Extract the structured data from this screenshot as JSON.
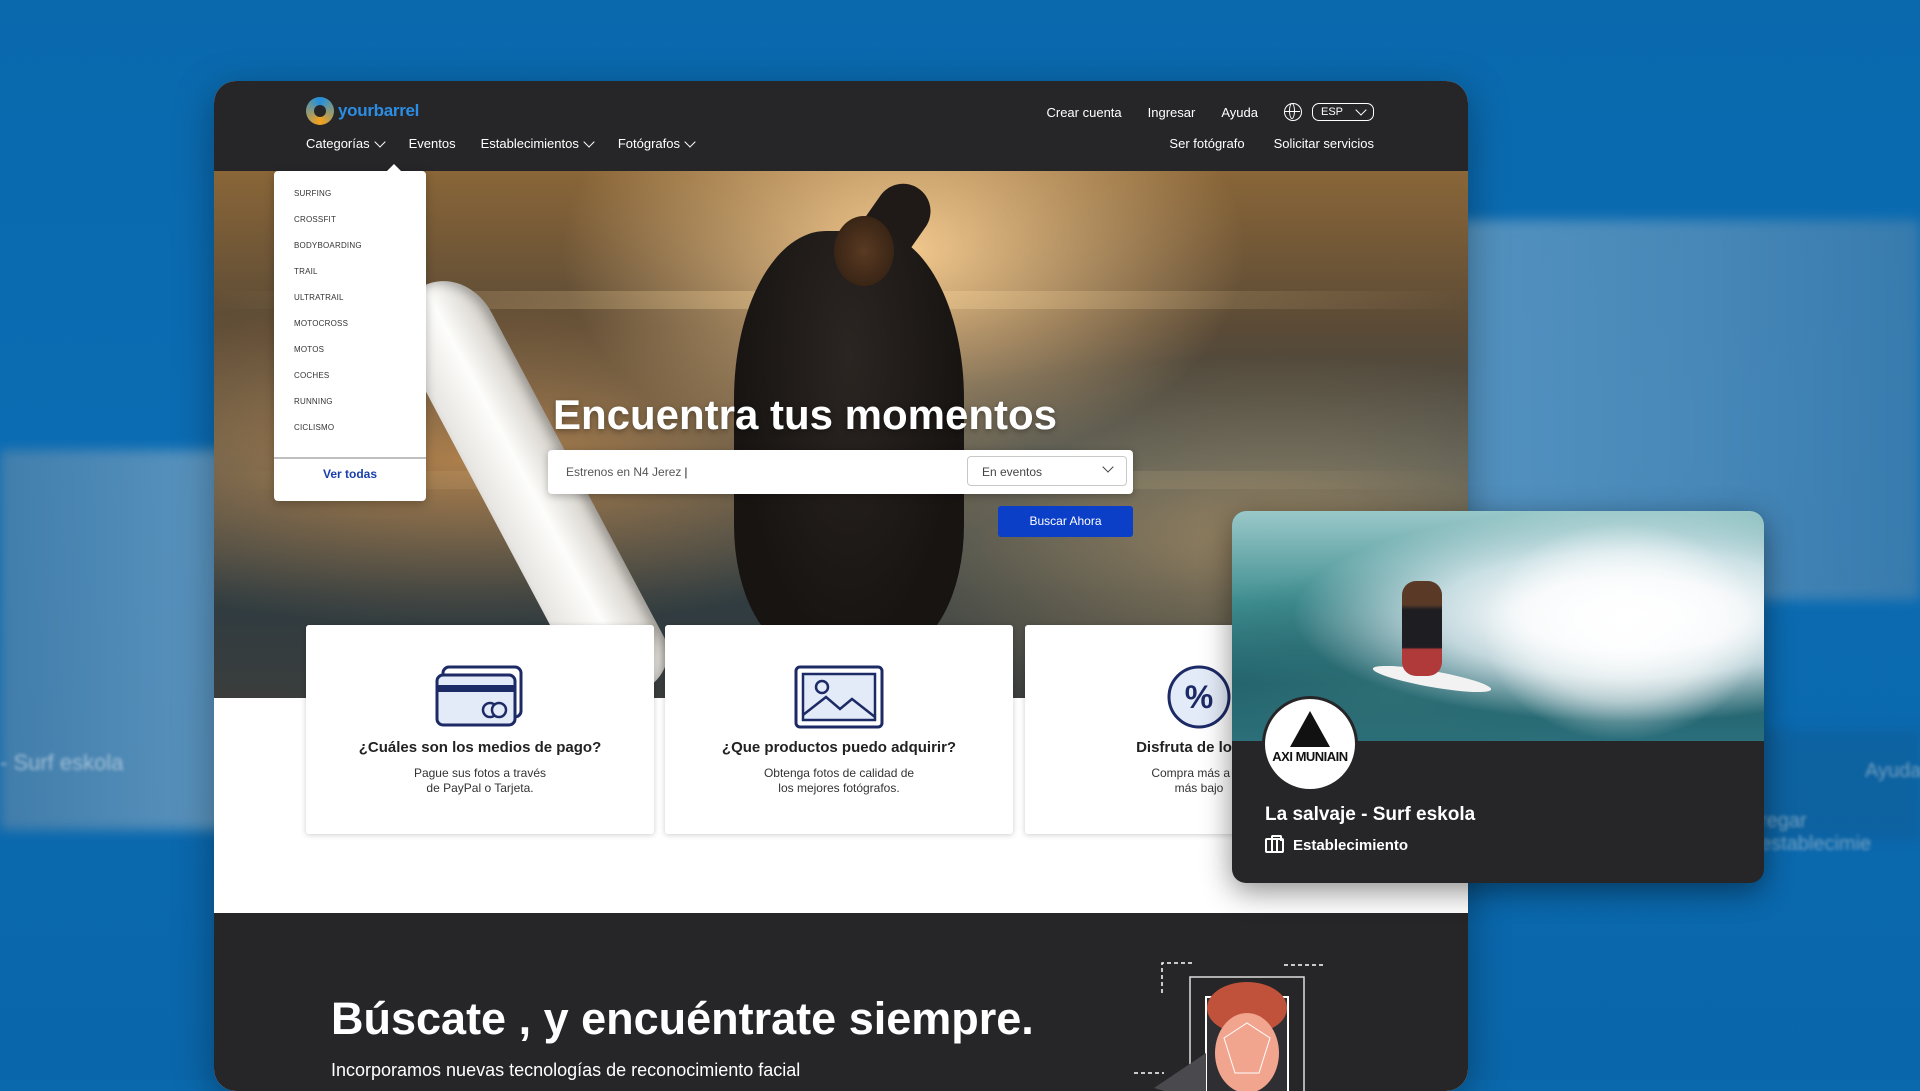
{
  "header": {
    "logo_text": "yourbarrel",
    "nav_left": [
      {
        "label": "Categorías",
        "has_chevron": true
      },
      {
        "label": "Eventos",
        "has_chevron": false
      },
      {
        "label": "Establecimientos",
        "has_chevron": true
      },
      {
        "label": "Fotógrafos",
        "has_chevron": true
      }
    ],
    "nav_right_top": {
      "create_account": "Crear cuenta",
      "login": "Ingresar",
      "help": "Ayuda",
      "language": "ESP"
    },
    "nav_right_bottom": {
      "photographer": "Ser fotógrafo",
      "services": "Solicitar servicios"
    }
  },
  "categories_dropdown": {
    "items": [
      "SURFING",
      "CROSSFIT",
      "BODYBOARDING",
      "TRAIL",
      "ULTRATRAIL",
      "MOTOCROSS",
      "MOTOS",
      "COCHES",
      "RUNNING",
      "CICLISMO"
    ],
    "see_all": "Ver todas"
  },
  "hero": {
    "title": "Encuentra tus momentos",
    "search_value": "Estrenos en N4 Jerez",
    "search_scope": "En eventos",
    "search_button": "Buscar Ahora"
  },
  "info_cards": [
    {
      "icon": "credit-cards-icon",
      "title": "¿Cuáles son los medios de pago?",
      "text": "Pague sus fotos a través\nde PayPal o Tarjeta."
    },
    {
      "icon": "image-icon",
      "title": "¿Que productos puedo adquirir?",
      "text": "Obtenga fotos de calidad de\nlos mejores fotógrafos."
    },
    {
      "icon": "percent-icon",
      "title": "Disfruta de los be",
      "text": "Compra más a un\nmás bajo"
    }
  ],
  "lower_section": {
    "title": "Búscate , y encuéntrate siempre.",
    "subtitle": "Incorporamos nuevas tecnologías de reconocimiento facial"
  },
  "profile_card": {
    "avatar_text": "AXI MUNIAIN",
    "name": "La salvaje - Surf eskola",
    "type": "Establecimiento",
    "type_icon": "briefcase-icon"
  },
  "background_ghosts": {
    "text_right_1": "Ayuda",
    "text_right_2": "regar establecimie",
    "text_left": "- Surf eskola"
  },
  "colors": {
    "page_bg": "#0a69ad",
    "header_bg": "#262628",
    "accent_blue": "#0b3fc8",
    "link_blue": "#1a3eaa",
    "icon_navy": "#1c2a66"
  }
}
